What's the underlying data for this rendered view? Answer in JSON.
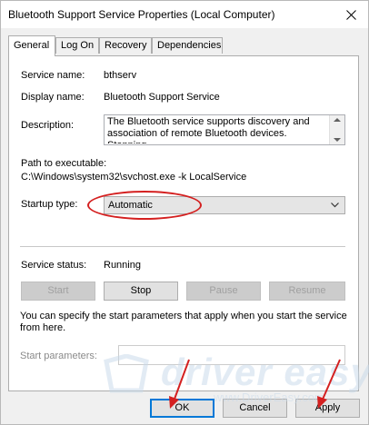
{
  "window": {
    "title": "Bluetooth Support Service Properties (Local Computer)"
  },
  "tabs": [
    {
      "label": "General",
      "active": true
    },
    {
      "label": "Log On",
      "active": false
    },
    {
      "label": "Recovery",
      "active": false
    },
    {
      "label": "Dependencies",
      "active": false
    }
  ],
  "general": {
    "service_name_label": "Service name:",
    "service_name": "bthserv",
    "display_name_label": "Display name:",
    "display_name": "Bluetooth Support Service",
    "description_label": "Description:",
    "description": "The Bluetooth service supports discovery and association of remote Bluetooth devices.  Stopping",
    "path_label": "Path to executable:",
    "path": "C:\\Windows\\system32\\svchost.exe -k LocalService",
    "startup_label": "Startup type:",
    "startup_value": "Automatic",
    "status_label": "Service status:",
    "status_value": "Running",
    "buttons": {
      "start": "Start",
      "stop": "Stop",
      "pause": "Pause",
      "resume": "Resume"
    },
    "info": "You can specify the start parameters that apply when you start the service from here.",
    "params_label": "Start parameters:",
    "params_value": ""
  },
  "footer": {
    "ok": "OK",
    "cancel": "Cancel",
    "apply": "Apply"
  },
  "watermark": {
    "brand": "driver easy",
    "url": "www.DriverEasy.com"
  },
  "colors": {
    "annotation": "#d42020",
    "focus": "#0078d7"
  },
  "icons": {
    "close": "close-icon",
    "dropdown": "chevron-down-icon"
  }
}
